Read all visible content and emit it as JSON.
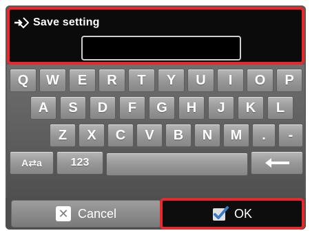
{
  "header": {
    "title": "Save setting",
    "title_icon": "arrow-into-diamond-icon",
    "input_value": "",
    "input_placeholder": ""
  },
  "keyboard": {
    "row1": [
      "Q",
      "W",
      "E",
      "R",
      "T",
      "Y",
      "U",
      "I",
      "O",
      "P"
    ],
    "row2": [
      "A",
      "S",
      "D",
      "F",
      "G",
      "H",
      "J",
      "K",
      "L"
    ],
    "row3": [
      "Z",
      "X",
      "C",
      "V",
      "B",
      "N",
      "M",
      ".",
      "-"
    ],
    "mode_label": "A⇄a",
    "numbers_label": "123",
    "space_label": "",
    "backspace_icon": "left-arrow-icon"
  },
  "buttons": {
    "cancel_label": "Cancel",
    "cancel_icon": "x-box-icon",
    "ok_label": "OK",
    "ok_icon": "checkmark-box-icon"
  },
  "colors": {
    "highlight_red": "#e8282d",
    "key_gray": "#a0a0a0",
    "panel_black": "#0b0b0b"
  }
}
